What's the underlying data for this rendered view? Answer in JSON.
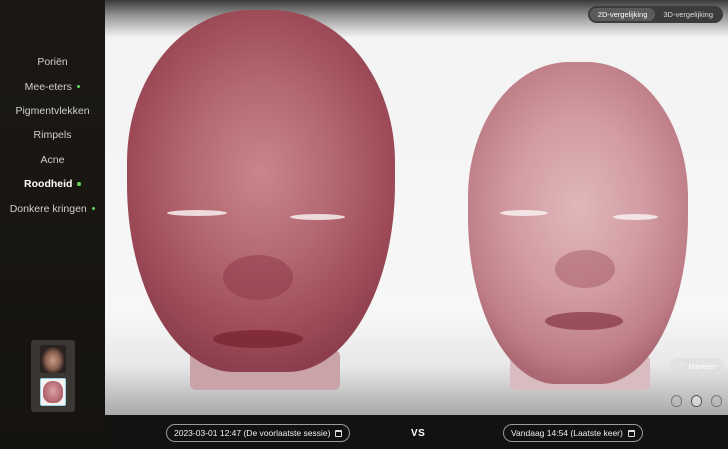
{
  "sidebar": {
    "items": [
      {
        "label": "Poriën",
        "dot": false,
        "active": false
      },
      {
        "label": "Mee-eters",
        "dot": true,
        "active": false
      },
      {
        "label": "Pigmentvlekken",
        "dot": false,
        "active": false
      },
      {
        "label": "Rimpels",
        "dot": false,
        "active": false
      },
      {
        "label": "Acne",
        "dot": false,
        "active": false
      },
      {
        "label": "Roodheid",
        "dot": true,
        "active": true
      },
      {
        "label": "Donkere kringen",
        "dot": true,
        "active": false
      }
    ],
    "dot_color": "#5fd35f"
  },
  "view_toggle": {
    "option_2d": "2D-vergelijking",
    "option_3d": "3D-vergelijking",
    "selected": "2D-vergelijking"
  },
  "mark_button": {
    "label": "Markeer"
  },
  "comparison": {
    "left_date": "2023-03-01 12:47 (De voorlaatste sessie)",
    "vs": "VS",
    "right_date": "Vandaag 14:54 (Laatste keer)"
  },
  "colors": {
    "redness_strong": "#9f4c58",
    "redness_light": "#d29ca2",
    "accent_green": "#5fd35f"
  }
}
